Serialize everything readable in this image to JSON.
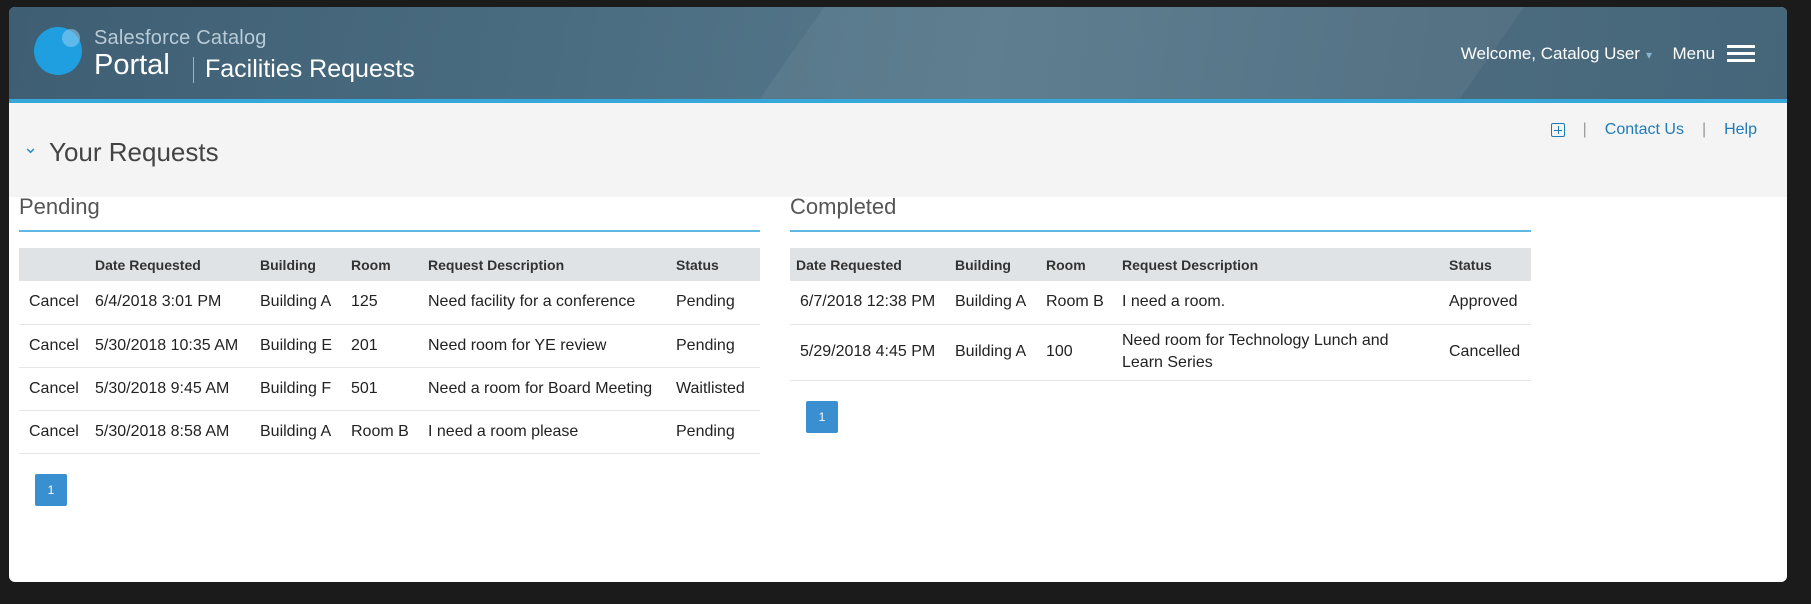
{
  "header": {
    "brand_sub": "Salesforce Catalog",
    "brand_main": "Portal",
    "page": "Facilities Requests",
    "welcome": "Welcome, Catalog User",
    "menu": "Menu"
  },
  "subbar": {
    "title": "Your Requests",
    "links": {
      "contact": "Contact Us",
      "help": "Help"
    }
  },
  "pending": {
    "title": "Pending",
    "columns": [
      "",
      "Date Requested",
      "Building",
      "Room",
      "Request Description",
      "Status"
    ],
    "rows": [
      {
        "action": "Cancel",
        "date": "6/4/2018 3:01 PM",
        "building": "Building A",
        "room": "125",
        "desc": "Need facility for a conference",
        "status": "Pending"
      },
      {
        "action": "Cancel",
        "date": "5/30/2018 10:35 AM",
        "building": "Building E",
        "room": "201",
        "desc": "Need room for YE review",
        "status": "Pending"
      },
      {
        "action": "Cancel",
        "date": "5/30/2018 9:45 AM",
        "building": "Building F",
        "room": "501",
        "desc": "Need a room for Board Meeting",
        "status": "Waitlisted"
      },
      {
        "action": "Cancel",
        "date": "5/30/2018 8:58 AM",
        "building": "Building A",
        "room": "Room B",
        "desc": "I need a room please",
        "status": "Pending"
      }
    ],
    "page": "1"
  },
  "completed": {
    "title": "Completed",
    "columns": [
      "Date Requested",
      "Building",
      "Room",
      "Request Description",
      "Status"
    ],
    "rows": [
      {
        "date": "6/7/2018 12:38 PM",
        "building": "Building A",
        "room": "Room B",
        "desc": "I need a room.",
        "status": "Approved"
      },
      {
        "date": "5/29/2018 4:45 PM",
        "building": "Building A",
        "room": "100",
        "desc": "Need room for Technology Lunch and Learn Series",
        "status": "Cancelled"
      }
    ],
    "page": "1"
  },
  "colors": {
    "accent": "#37a6d9",
    "header": "#4a6c80",
    "pager": "#3a8fd1"
  }
}
